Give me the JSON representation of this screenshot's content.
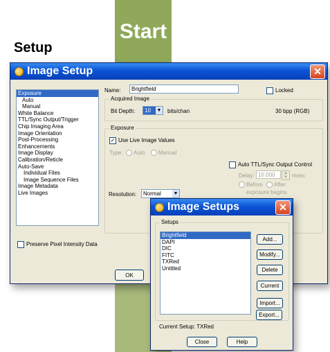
{
  "flow": {
    "start_label": "Start",
    "section_title": "Setup"
  },
  "image_setup": {
    "title": "Image Setup",
    "sidebar_items": [
      {
        "label": "Exposure",
        "selected": true,
        "indent": 0
      },
      {
        "label": "Auto",
        "indent": 1
      },
      {
        "label": "Manual",
        "indent": 1
      },
      {
        "label": "White Balance",
        "indent": 0
      },
      {
        "label": "TTL/Sync Output/Trigger",
        "indent": 0
      },
      {
        "label": "Chip Imaging Area",
        "indent": 0
      },
      {
        "label": "Image Orientation",
        "indent": 0
      },
      {
        "label": "Post-Processing",
        "indent": 0
      },
      {
        "label": "Enhancements",
        "indent": 0
      },
      {
        "label": "Image Display",
        "indent": 0
      },
      {
        "label": "Calibration/Reticle",
        "indent": 0
      },
      {
        "label": "Auto-Save",
        "indent": 0
      },
      {
        "label": "Individual Files",
        "indent": 2
      },
      {
        "label": "Image Sequence Files",
        "indent": 2
      },
      {
        "label": "Image Metadata",
        "indent": 0
      },
      {
        "label": "Live Images",
        "indent": 0
      }
    ],
    "name_label": "Name:",
    "name_value": "Brightfield",
    "locked_label": "Locked",
    "acquired_image_label": "Acquired Image",
    "bit_depth_label": "Bit Depth:",
    "bit_depth_value": "10",
    "bits_unit": "bits/chan",
    "bpp_text": "30 bpp (RGB)",
    "exposure_group_label": "Exposure",
    "use_live_label": "Use Live Image Values",
    "type_label": "Type:",
    "auto_radio": "Auto",
    "manual_radio": "Manual",
    "auto_ttl_label": "Auto TTL/Sync Output Control",
    "delay_label": "Delay:",
    "delay_value": "10.000",
    "delay_unit": "msec",
    "before_label": "Before",
    "after_label": "After",
    "exposure_begins": "exposure begins",
    "resolution_label": "Resolution:",
    "resolution_value": "Normal",
    "preserve_label": "Preserve Pixel Intensity Data",
    "ok_label": "OK"
  },
  "image_setups": {
    "title": "Image Setups",
    "group_label": "Setups",
    "items": [
      "Brightfield",
      "DAPI",
      "DIC",
      "FITC",
      "TXRed",
      "Untitled"
    ],
    "selected_index": 0,
    "buttons": {
      "add": "Add...",
      "modify": "Modify...",
      "delete": "Delete",
      "current": "Current",
      "import": "Import...",
      "export": "Export..."
    },
    "current_setup": "Current Setup: TXRed",
    "close_label": "Close",
    "help_label": "Help"
  },
  "colors": {
    "band": "#a8b97a",
    "start_box": "#8fa85a",
    "titlebar": "#0a54d6",
    "selection": "#316ac5"
  }
}
